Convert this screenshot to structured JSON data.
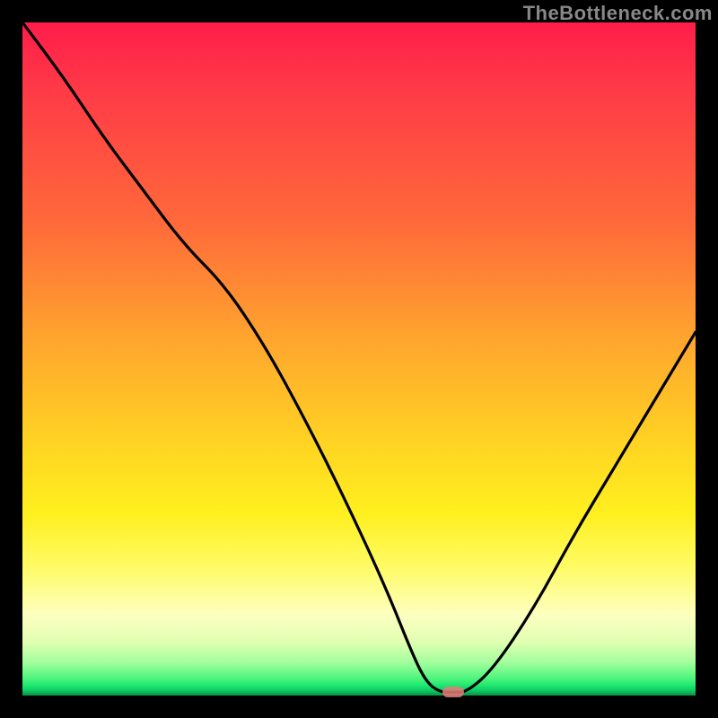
{
  "watermark": "TheBottleneck.com",
  "colors": {
    "frame": "#000000",
    "curve": "#000000",
    "marker": "#e77a7a",
    "gradient_stops": [
      "#ff1d4a",
      "#ff3a47",
      "#ff6a3a",
      "#ffa52e",
      "#ffd223",
      "#fff01f",
      "#fffb66",
      "#fdffc0",
      "#e1ffb2",
      "#a5ff9e",
      "#4cf57c",
      "#1de771",
      "#0fce62",
      "#0a8f44"
    ]
  },
  "chart_data": {
    "type": "line",
    "title": "",
    "xlabel": "",
    "ylabel": "",
    "xlim": [
      0,
      100
    ],
    "ylim": [
      0,
      100
    ],
    "x": [
      0,
      6,
      12,
      18,
      24,
      30,
      36,
      42,
      48,
      54,
      58,
      60,
      62,
      64,
      66,
      70,
      76,
      82,
      88,
      94,
      100
    ],
    "y": [
      100,
      92,
      83,
      75,
      67,
      61,
      52,
      41,
      29,
      16,
      6,
      2,
      0.5,
      0.5,
      0.5,
      4,
      13,
      24,
      34,
      44,
      54
    ],
    "marker": {
      "x": 64,
      "y": 0.5
    },
    "notes": "y is percentage height from bottom; curve descends steeply from top-left, flattens at the floor near x≈62–66, then rises to the right edge; a small rounded marker sits on the flat at x≈64."
  }
}
